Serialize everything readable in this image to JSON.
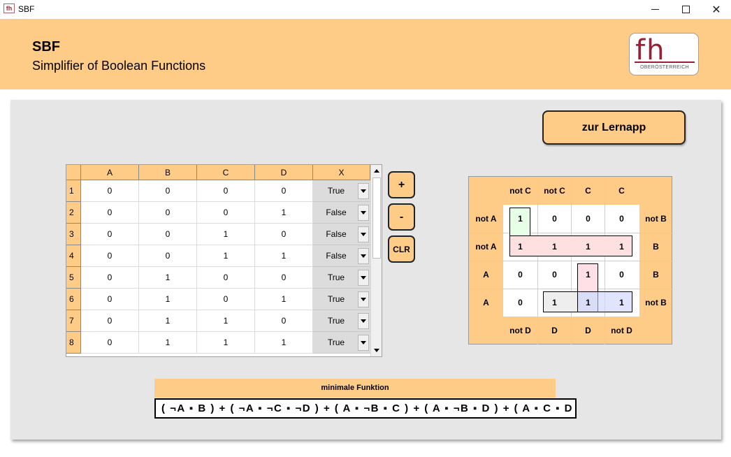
{
  "window": {
    "icon_text": "fh",
    "title": "SBF",
    "minimize_icon": "minimize-icon",
    "maximize_icon": "maximize-icon",
    "close_icon": "close-icon",
    "close_glyph": "✕"
  },
  "header": {
    "app_name": "SBF",
    "subtitle": "Simplifier of Boolean Functions",
    "logo_mark": "fh",
    "logo_text": "OBERÖSTERREICH",
    "background_color": "#ffcc88"
  },
  "main": {
    "lernapp_button": "zur Lernapp",
    "table": {
      "columns": [
        "A",
        "B",
        "C",
        "D",
        "X"
      ],
      "rows": [
        {
          "n": "1",
          "a": "0",
          "b": "0",
          "c": "0",
          "d": "0",
          "x": "True"
        },
        {
          "n": "2",
          "a": "0",
          "b": "0",
          "c": "0",
          "d": "1",
          "x": "False"
        },
        {
          "n": "3",
          "a": "0",
          "b": "0",
          "c": "1",
          "d": "0",
          "x": "False"
        },
        {
          "n": "4",
          "a": "0",
          "b": "0",
          "c": "1",
          "d": "1",
          "x": "False"
        },
        {
          "n": "5",
          "a": "0",
          "b": "1",
          "c": "0",
          "d": "0",
          "x": "True"
        },
        {
          "n": "6",
          "a": "0",
          "b": "1",
          "c": "0",
          "d": "1",
          "x": "True"
        },
        {
          "n": "7",
          "a": "0",
          "b": "1",
          "c": "1",
          "d": "0",
          "x": "True"
        },
        {
          "n": "8",
          "a": "0",
          "b": "1",
          "c": "1",
          "d": "1",
          "x": "True"
        }
      ],
      "scroll_position_fraction": 0.0
    },
    "buttons": {
      "plus": "+",
      "minus": "-",
      "clear": "CLR"
    },
    "kmap": {
      "top_labels": [
        "not C",
        "not C",
        "C",
        "C"
      ],
      "bottom_labels": [
        "not D",
        "D",
        "D",
        "not D"
      ],
      "left_labels": [
        "not A",
        "not A",
        "A",
        "A"
      ],
      "right_labels": [
        "not B",
        "B",
        "B",
        "not B"
      ],
      "values": [
        [
          "1",
          "0",
          "0",
          "0"
        ],
        [
          "1",
          "1",
          "1",
          "1"
        ],
        [
          "0",
          "0",
          "1",
          "0"
        ],
        [
          "0",
          "1",
          "1",
          "1"
        ]
      ],
      "group_colors": [
        "#e6ffe6",
        "#ffe0e0",
        "#ffe0e6",
        "#eeeeee",
        "#e0e4ff"
      ]
    },
    "function": {
      "label": "minimale Funktion",
      "expression": "( ¬A ▪ B ) + ( ¬A ▪ ¬C ▪ ¬D ) + ( A ▪ ¬B ▪ C ) + ( A ▪ ¬B ▪ D ) + ( A ▪ C ▪ D )"
    }
  }
}
